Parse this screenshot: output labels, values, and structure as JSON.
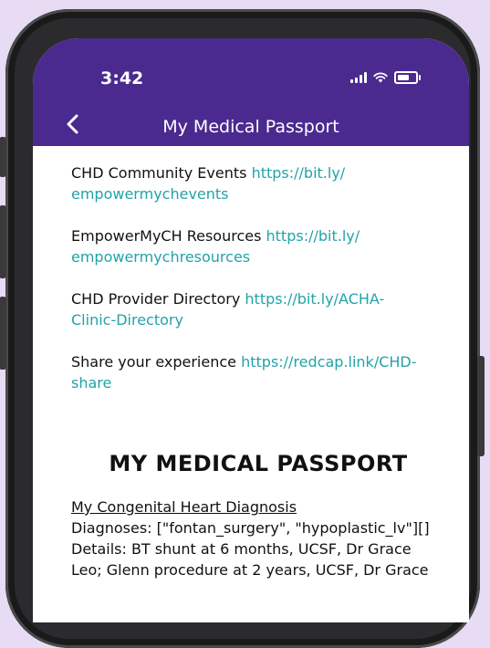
{
  "status_bar": {
    "time": "3:42"
  },
  "nav": {
    "title": "My Medical Passport"
  },
  "links": [
    {
      "label": "CHD Community Events ",
      "url_part1": "https://bit.ly/",
      "url_part2": "empowermychevents"
    },
    {
      "label": "EmpowerMyCH Resources ",
      "url_part1": "https://bit.ly/",
      "url_part2": "empowermychresources"
    },
    {
      "label": "CHD Provider Directory ",
      "url_part1": "https://bit.ly/ACHA-",
      "url_part2": "Clinic-Directory"
    },
    {
      "label": "Share your experience ",
      "url_part1": "https://redcap.link/CHD-",
      "url_part2": "share"
    }
  ],
  "passport": {
    "heading": "MY MEDICAL PASSPORT",
    "section_title": "My Congenital Heart Diagnosis",
    "diagnoses": "Diagnoses: [\"fontan_surgery\", \"hypoplastic_lv\"][]",
    "details_line1": "Details: BT shunt at 6 months, UCSF, Dr Grace",
    "details_line2": "Leo; Glenn procedure at 2 years, UCSF, Dr Grace"
  },
  "colors": {
    "background": "#e7dcf4",
    "header": "#4b2a8f",
    "link": "#22a3a8"
  },
  "icons": [
    "back-chevron-icon",
    "signal-icon",
    "wifi-icon",
    "battery-icon"
  ]
}
